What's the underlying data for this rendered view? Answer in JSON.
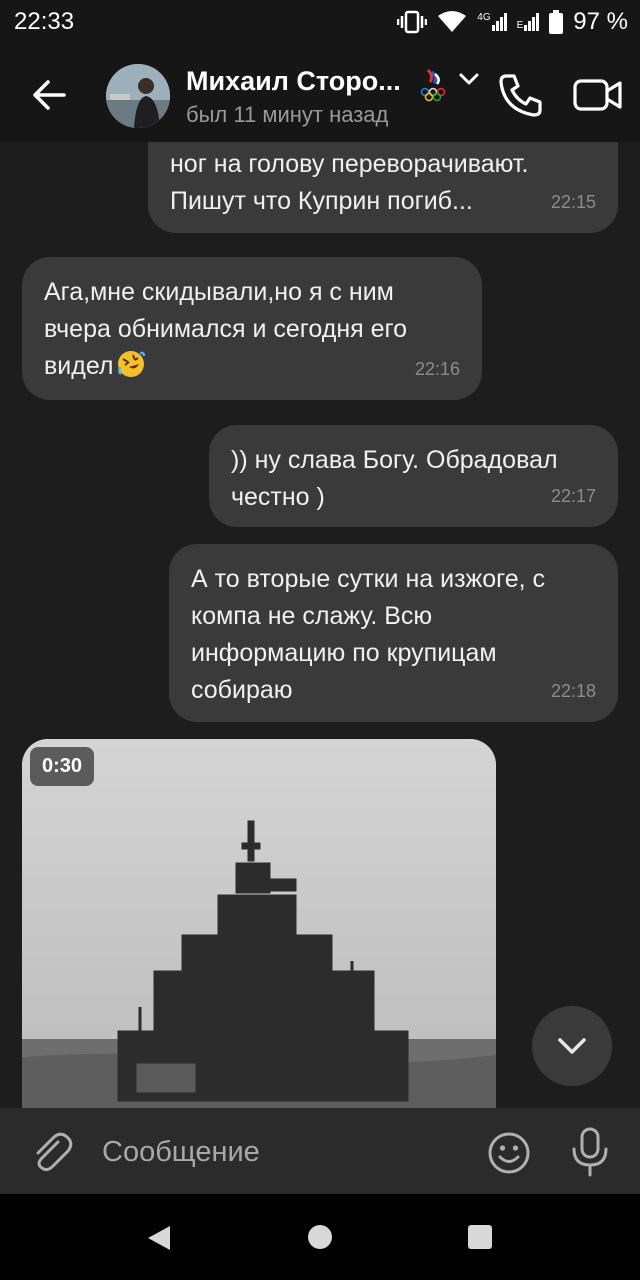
{
  "status_bar": {
    "time": "22:33",
    "network": "4G",
    "network_secondary": "E",
    "battery": "97 %"
  },
  "header": {
    "contact_name": "Михаил Сторо...",
    "contact_status": "был 11 минут назад",
    "icons": [
      "back-arrow-icon",
      "olympic-emblem-icon",
      "chevron-down-icon",
      "phone-icon",
      "video-camera-icon"
    ]
  },
  "messages": [
    {
      "direction": "outgoing",
      "text": "ног на голову переворачивают.\nПишут что Куприн погиб...",
      "time": "22:15"
    },
    {
      "direction": "incoming",
      "text": "Ага,мне скидывали,но я с ним\nвчера обнимался и сегодня его\nвидел",
      "emoji": "rolling-on-floor-laughing",
      "time": "22:16"
    },
    {
      "direction": "outgoing",
      "text": ")) ну слава Богу. Обрадовал\nчестно )",
      "time": "22:17"
    },
    {
      "direction": "outgoing",
      "text": "А то вторые сутки на изжоге, с\nкомпа не слажу. Всю\nинформацию по крупицам\nсобираю",
      "time": "22:18"
    }
  ],
  "video_message": {
    "direction": "incoming",
    "duration": "0:30"
  },
  "input_bar": {
    "placeholder": "Сообщение",
    "icons": [
      "paperclip-icon",
      "emoji-icon",
      "microphone-icon"
    ]
  },
  "colors": {
    "background": "#1d1d1d",
    "bubble": "#3a3a3a",
    "header": "#161616",
    "input_bar": "#2b2b2b"
  }
}
